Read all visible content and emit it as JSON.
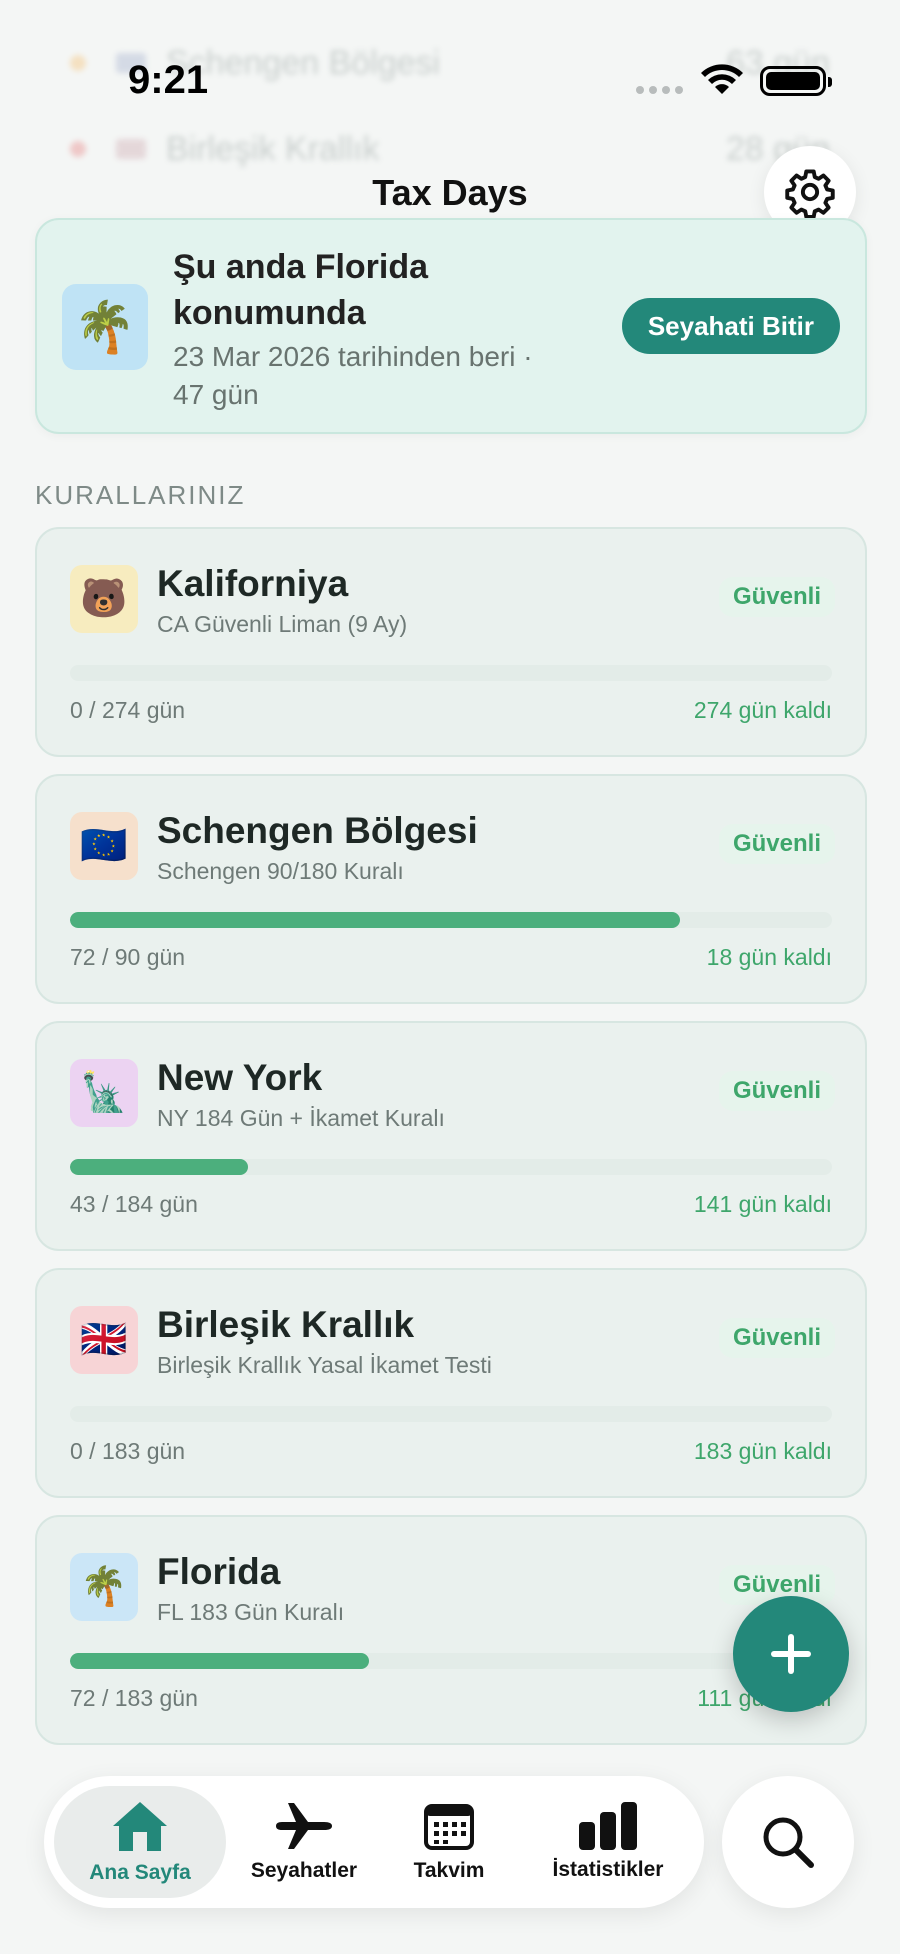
{
  "status_bar": {
    "time": "9:21"
  },
  "background_rows": [
    {
      "label": "Schengen Bölgesi",
      "value": "63 gün",
      "dot_color": "#f4b860"
    },
    {
      "label": "Birleşik Krallık",
      "value": "28 gün",
      "dot_color": "#e57373"
    }
  ],
  "header": {
    "title": "Tax Days",
    "settings_icon": "gear-icon"
  },
  "current_location": {
    "icon": "🌴",
    "heading": "Şu anda Florida konumunda",
    "since": "23 Mar 2026 tarihinden beri ·",
    "days": "47 gün",
    "end_trip_label": "Seyahati Bitir"
  },
  "rules_section": {
    "label": "KURALLARINIZ",
    "rules": [
      {
        "icon": "🐻",
        "icon_bg": "#f7ecbf",
        "name": "Kaliforniya",
        "desc": "CA Güvenli Liman (9 Ay)",
        "status": "Güvenli",
        "used": "0 / 274 gün",
        "left": "274 gün kaldı",
        "progress": 0.0
      },
      {
        "icon": "🇪🇺",
        "icon_bg": "#f6e0cc",
        "name": "Schengen Bölgesi",
        "desc": "Schengen 90/180 Kuralı",
        "status": "Güvenli",
        "used": "72 / 90 gün",
        "left": "18 gün kaldı",
        "progress": 0.8
      },
      {
        "icon": "🗽",
        "icon_bg": "#ecd3f2",
        "name": "New York",
        "desc": "NY 184 Gün + İkamet Kuralı",
        "status": "Güvenli",
        "used": "43 / 184 gün",
        "left": "141 gün kaldı",
        "progress": 0.234
      },
      {
        "icon": "🇬🇧",
        "icon_bg": "#f7d4d6",
        "name": "Birleşik Krallık",
        "desc": "Birleşik Krallık Yasal İkamet Testi",
        "status": "Güvenli",
        "used": "0 / 183 gün",
        "left": "183 gün kaldı",
        "progress": 0.0
      },
      {
        "icon": "🌴",
        "icon_bg": "#cbe6f7",
        "name": "Florida",
        "desc": "FL 183 Gün Kuralı",
        "status": "Güvenli",
        "used": "72 / 183 gün",
        "left": "111 gün kaldı",
        "progress": 0.393
      }
    ]
  },
  "fab": {
    "icon": "plus-icon"
  },
  "tab_bar": {
    "tabs": [
      {
        "label": "Ana Sayfa",
        "icon": "home-icon",
        "active": true
      },
      {
        "label": "Seyahatler",
        "icon": "airplane-icon",
        "active": false
      },
      {
        "label": "Takvim",
        "icon": "calendar-icon",
        "active": false
      },
      {
        "label": "İstatistikler",
        "icon": "bar-chart-icon",
        "active": false
      }
    ],
    "search_icon": "search-icon"
  },
  "colors": {
    "accent": "#23887a",
    "safe_green": "#3ea66b",
    "progress_green": "#4caf7d"
  }
}
